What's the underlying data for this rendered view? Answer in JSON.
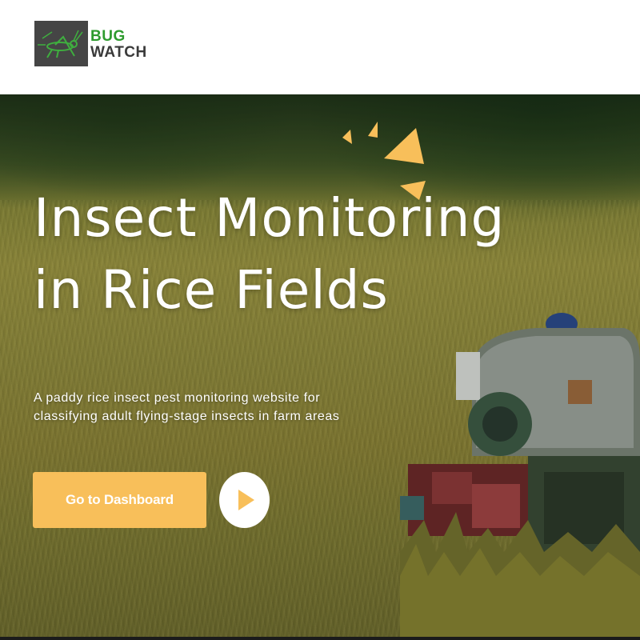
{
  "brand": {
    "line1": "BUG",
    "line2": "WATCH",
    "line1_color": "#2e9b2e",
    "line2_color": "#3a3a3a",
    "logo_icon": "grasshopper-icon"
  },
  "hero": {
    "title_line1": "Insect Monitoring",
    "title_line2": "in Rice Fields",
    "subtitle_line1": "A paddy rice insect pest monitoring website for",
    "subtitle_line2": "classifying adult flying-stage insects in farm areas",
    "cta_label": "Go to Dashboard",
    "play_icon": "play-icon",
    "accent_color": "#f8bf5a"
  }
}
